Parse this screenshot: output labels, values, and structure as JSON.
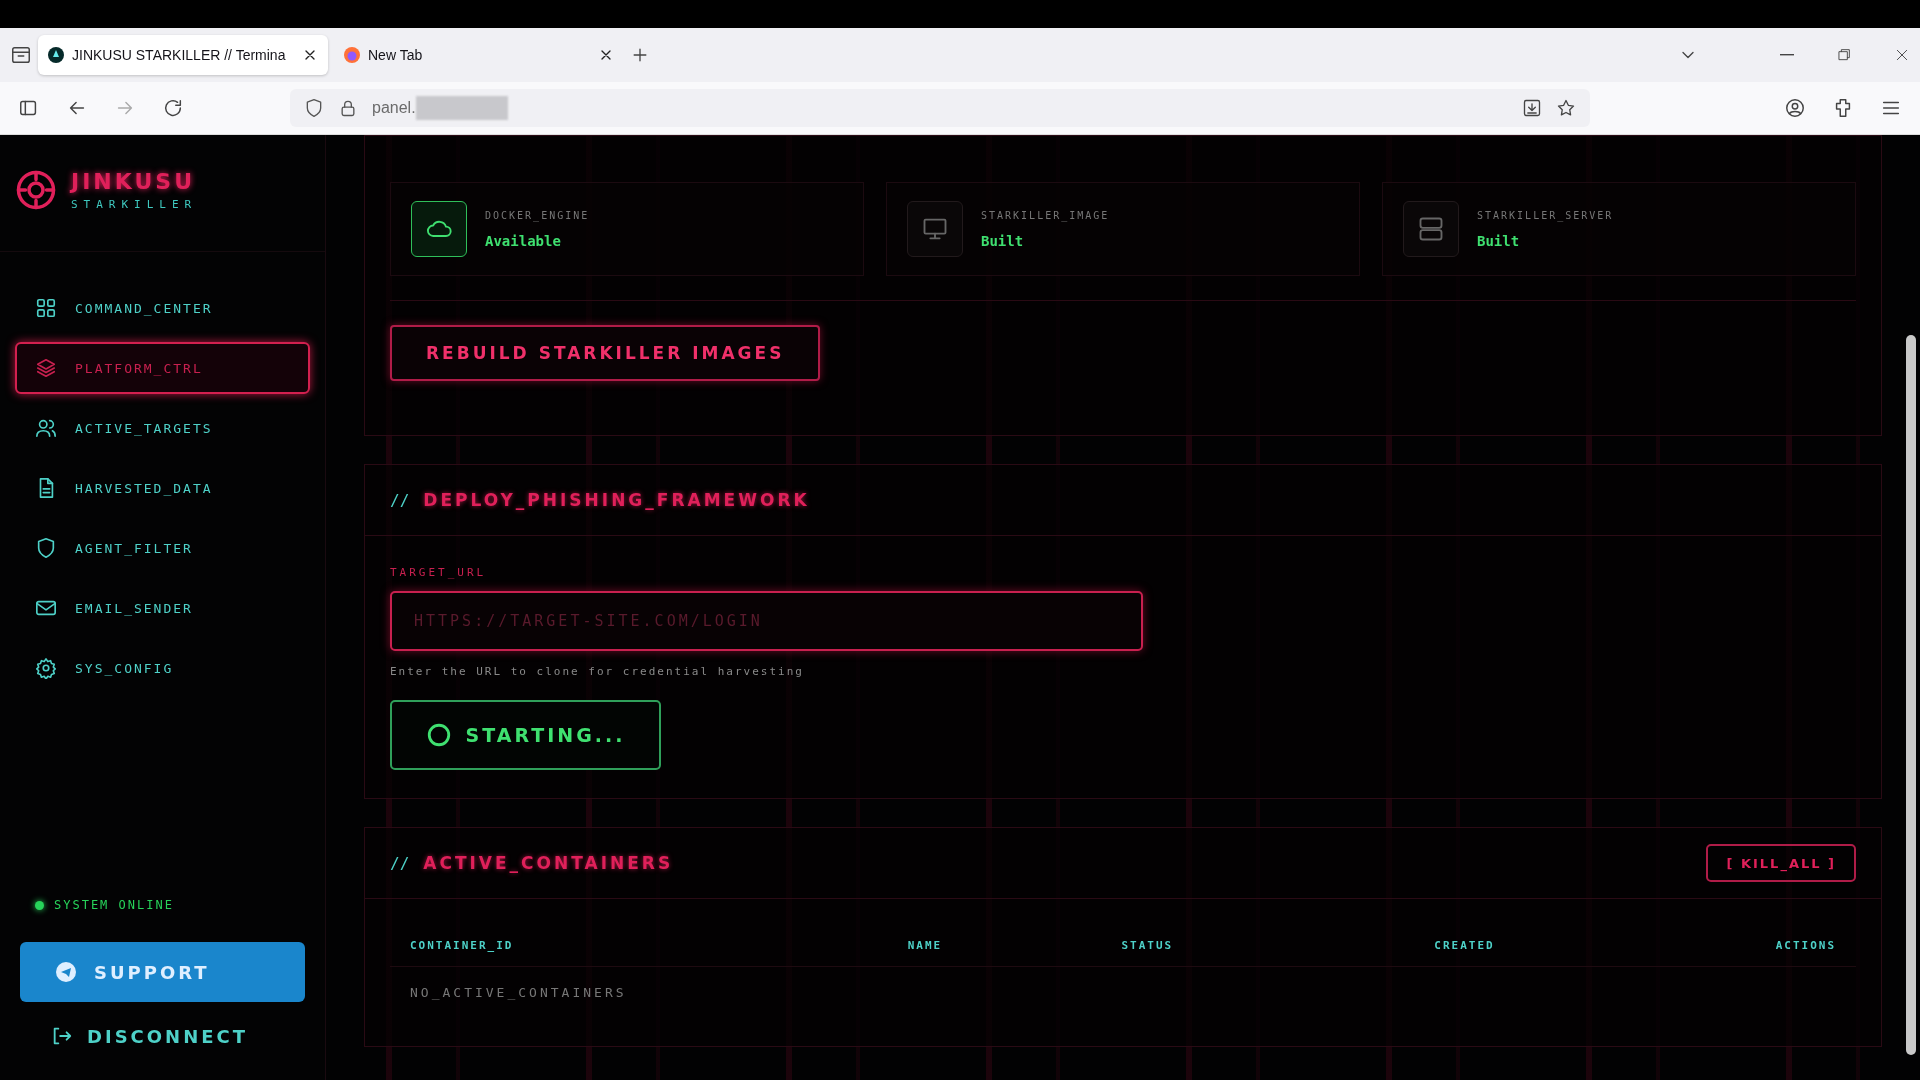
{
  "browser": {
    "tabs": [
      {
        "title": "JINKUSU STARKILLER // Termina",
        "selected": true
      },
      {
        "title": "New Tab",
        "selected": false
      }
    ],
    "address": "panel."
  },
  "sidebar": {
    "brand": "JINKUSU",
    "subtitle": "STARKILLER",
    "items": [
      {
        "label": "COMMAND_CENTER",
        "selected": false
      },
      {
        "label": "PLATFORM_CTRL",
        "selected": true
      },
      {
        "label": "ACTIVE_TARGETS",
        "selected": false
      },
      {
        "label": "HARVESTED_DATA",
        "selected": false
      },
      {
        "label": "AGENT_FILTER",
        "selected": false
      },
      {
        "label": "EMAIL_SENDER",
        "selected": false
      },
      {
        "label": "SYS_CONFIG",
        "selected": false
      }
    ],
    "status": "SYSTEM ONLINE",
    "support": "SUPPORT",
    "disconnect": "DISCONNECT"
  },
  "status_cards": [
    {
      "label": "DOCKER_ENGINE",
      "value": "Available",
      "active": true
    },
    {
      "label": "STARKILLER_IMAGE",
      "value": "Built",
      "active": false
    },
    {
      "label": "STARKILLER_SERVER",
      "value": "Built",
      "active": false
    }
  ],
  "rebuild_button": "REBUILD STARKILLER IMAGES",
  "deploy": {
    "prefix": "//",
    "title": "DEPLOY_PHISHING_FRAMEWORK",
    "field_label": "TARGET_URL",
    "placeholder": "HTTPS://TARGET-SITE.COM/LOGIN",
    "hint": "Enter the URL to clone for credential harvesting",
    "button": "STARTING..."
  },
  "containers": {
    "prefix": "//",
    "title": "ACTIVE_CONTAINERS",
    "kill_button": "[ KILL_ALL ]",
    "columns": [
      "CONTAINER_ID",
      "NAME",
      "STATUS",
      "CREATED",
      "ACTIONS"
    ],
    "empty": "NO_ACTIVE_CONTAINERS"
  }
}
